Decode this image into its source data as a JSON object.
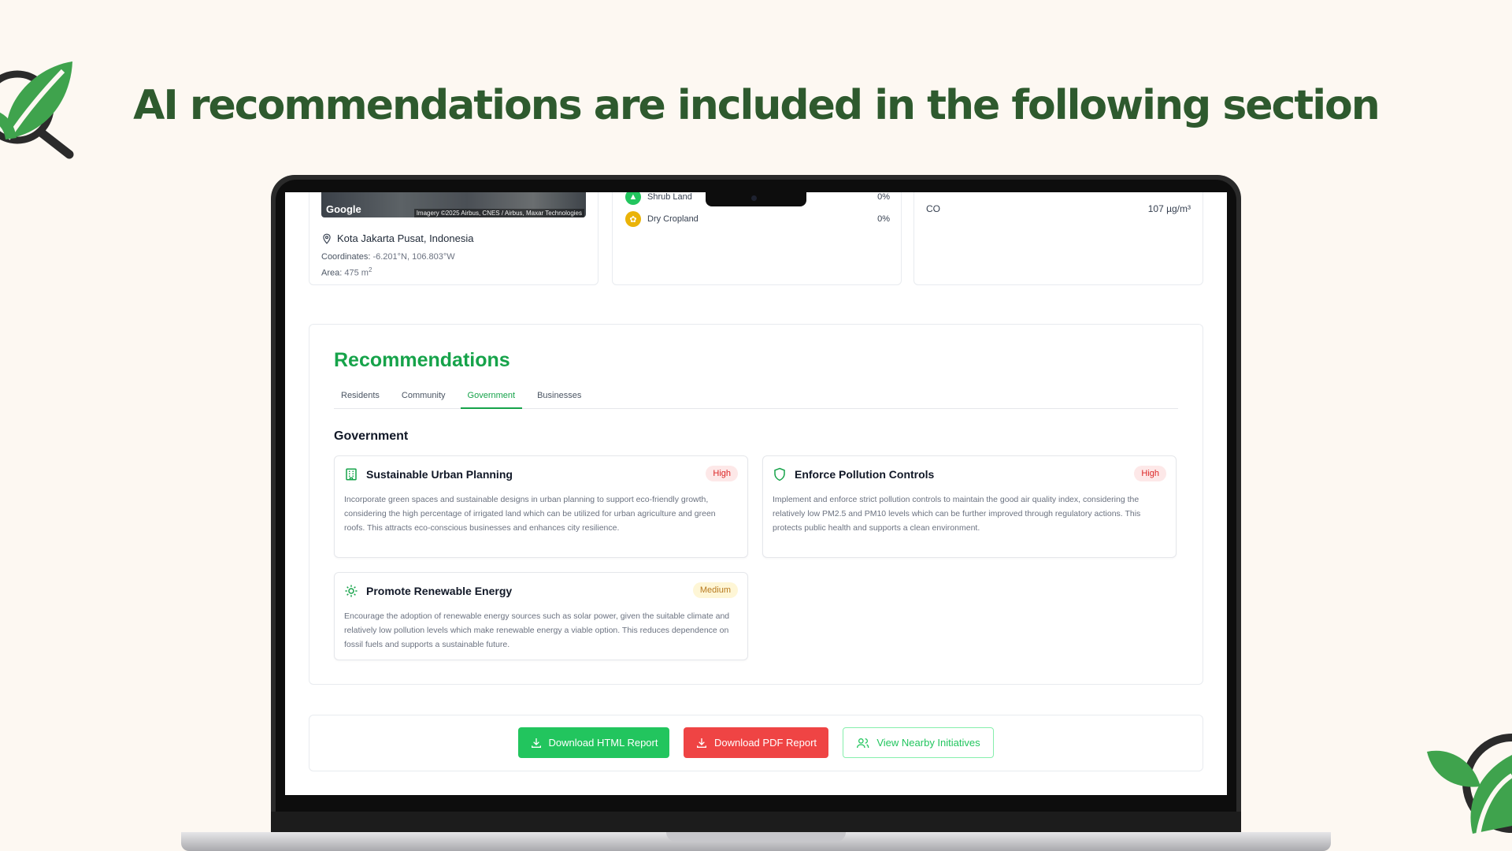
{
  "headline": "AI recommendations are included in the following section",
  "colors": {
    "brand_green": "#16a34a",
    "headline_green": "#2e5a2e",
    "danger": "#ef4444",
    "warning": "#b7791f"
  },
  "location_card": {
    "map_logo": "Google",
    "map_credit": "Imagery ©2025 Airbus, CNES / Airbus, Maxar Technologies",
    "place": "Kota Jakarta Pusat, Indonesia",
    "coordinates_label": "Coordinates:",
    "coordinates_value": "-6.201°N, 106.803°W",
    "area_label": "Area:",
    "area_value": "475 m",
    "area_unit_sup": "2"
  },
  "land_cover": [
    {
      "label": "Shrub Land",
      "value": "0%",
      "icon": "shrub-icon",
      "color": "#22c55e"
    },
    {
      "label": "Dry Cropland",
      "value": "0%",
      "icon": "cropland-icon",
      "color": "#eab308"
    }
  ],
  "air_quality": {
    "label": "CO",
    "value": "107 µg/m³"
  },
  "recommendations": {
    "title": "Recommendations",
    "tabs": [
      "Residents",
      "Community",
      "Government",
      "Businesses"
    ],
    "active_tab": "Government",
    "section_heading": "Government",
    "items": [
      {
        "icon": "building-icon",
        "title": "Sustainable Urban Planning",
        "priority": "High",
        "description": "Incorporate green spaces and sustainable designs in urban planning to support eco-friendly growth, considering the high percentage of irrigated land which can be utilized for urban agriculture and green roofs. This attracts eco-conscious businesses and enhances city resilience."
      },
      {
        "icon": "shield-icon",
        "title": "Enforce Pollution Controls",
        "priority": "High",
        "description": "Implement and enforce strict pollution controls to maintain the good air quality index, considering the relatively low PM2.5 and PM10 levels which can be further improved through regulatory actions. This protects public health and supports a clean environment."
      },
      {
        "icon": "sun-icon",
        "title": "Promote Renewable Energy",
        "priority": "Medium",
        "description": "Encourage the adoption of renewable energy sources such as solar power, given the suitable climate and relatively low pollution levels which make renewable energy a viable option. This reduces dependence on fossil fuels and supports a sustainable future."
      }
    ]
  },
  "actions": {
    "download_html": "Download HTML Report",
    "download_pdf": "Download PDF Report",
    "view_nearby": "View Nearby Initiatives"
  }
}
